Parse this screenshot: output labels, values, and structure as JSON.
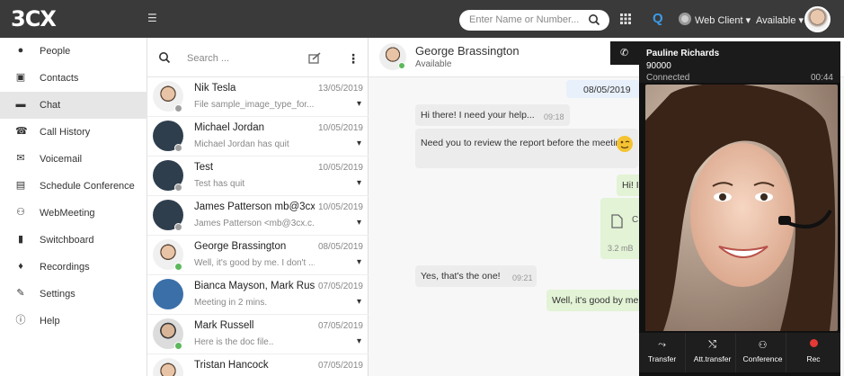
{
  "topbar": {
    "logo": "3CX",
    "search_placeholder": "Enter Name or Number...",
    "web_client": "Web Client",
    "presence": "Available"
  },
  "nav": [
    {
      "label": "People",
      "icon": "person-icon"
    },
    {
      "label": "Contacts",
      "icon": "contacts-icon"
    },
    {
      "label": "Chat",
      "icon": "chat-icon",
      "active": true
    },
    {
      "label": "Call History",
      "icon": "phone-icon"
    },
    {
      "label": "Voicemail",
      "icon": "voicemail-icon"
    },
    {
      "label": "Schedule Conference",
      "icon": "calendar-icon"
    },
    {
      "label": "WebMeeting",
      "icon": "webmeeting-icon"
    },
    {
      "label": "Switchboard",
      "icon": "switchboard-icon"
    },
    {
      "label": "Recordings",
      "icon": "microphone-icon"
    },
    {
      "label": "Settings",
      "icon": "wrench-icon"
    },
    {
      "label": "Help",
      "icon": "info-icon"
    }
  ],
  "chatlist": {
    "search_placeholder": "Search ...",
    "items": [
      {
        "name": "Nik Tesla",
        "date": "13/05/2019",
        "preview": "File sample_image_type_for...",
        "avatar": "face",
        "status": "#9e9e9e"
      },
      {
        "name": "Michael Jordan",
        "date": "10/05/2019",
        "preview": "Michael Jordan has quit",
        "avatar": "dark",
        "status": "#9e9e9e"
      },
      {
        "name": "Test",
        "date": "10/05/2019",
        "preview": "Test has quit",
        "avatar": "dark",
        "status": "#9e9e9e"
      },
      {
        "name": "James Patterson mb@3cx...",
        "date": "10/05/2019",
        "preview": "James Patterson <mb@3cx.c...",
        "avatar": "dark",
        "status": "#9e9e9e"
      },
      {
        "name": "George Brassington",
        "date": "08/05/2019",
        "preview": "Well, it's good by me. I don't ...",
        "avatar": "face",
        "status": "#5cb85c"
      },
      {
        "name": "Bianca Mayson, Mark Rus...",
        "date": "07/05/2019",
        "preview": "Meeting in 2 mins.",
        "avatar": "group",
        "status": ""
      },
      {
        "name": "Mark Russell",
        "date": "07/05/2019",
        "preview": "Here is the doc file..",
        "avatar": "face2",
        "status": "#5cb85c"
      },
      {
        "name": "Tristan Hancock",
        "date": "07/05/2019",
        "preview": "",
        "avatar": "face",
        "status": ""
      }
    ]
  },
  "conversation": {
    "contact_name": "George Brassington",
    "contact_status": "Available",
    "date_marker": "08/05/2019",
    "messages": [
      {
        "text": "Hi there! I need your help...",
        "time": "09:18",
        "dir": "in"
      },
      {
        "text": "Need you to review the report before the meeting?",
        "time": "",
        "dir": "in"
      },
      {
        "text": "Hi! I",
        "time": "",
        "dir": "out"
      },
      {
        "text": "3.2 mB",
        "time": "",
        "dir": "out"
      },
      {
        "text": "Yes, that's the one!",
        "time": "09:21",
        "dir": "in"
      },
      {
        "text": "Well, it's good by me. I",
        "time": "",
        "dir": "out"
      }
    ]
  },
  "call": {
    "name": "Pauline Richards",
    "number": "90000",
    "status": "Connected",
    "timer": "00:44",
    "buttons": [
      "Transfer",
      "Att.transfer",
      "Conference",
      "Rec"
    ]
  }
}
